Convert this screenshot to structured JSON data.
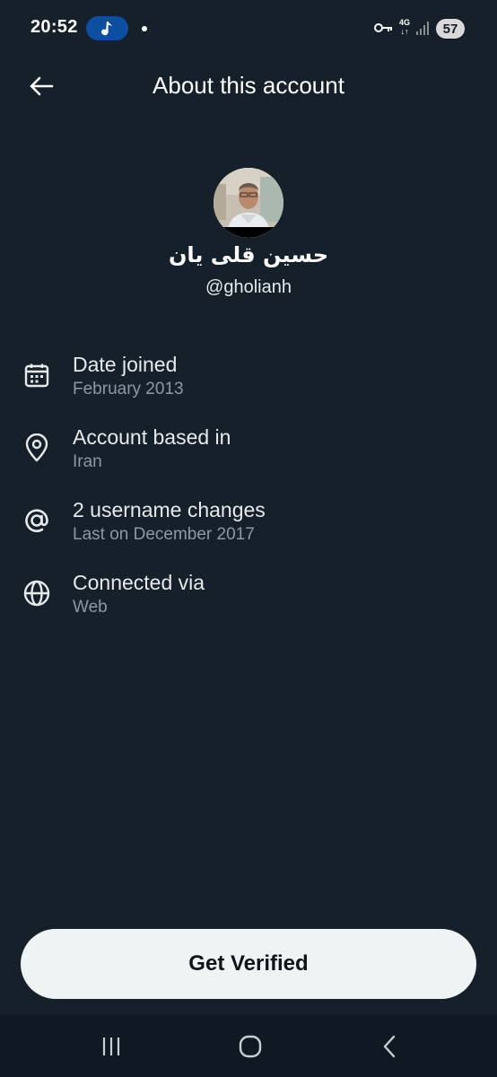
{
  "status_bar": {
    "time": "20:52",
    "network": "4G",
    "battery": "57",
    "icons": [
      "music-note-icon",
      "key-icon",
      "signal-icon"
    ]
  },
  "header": {
    "title": "About this account",
    "back_icon": "arrow-left-icon"
  },
  "profile": {
    "display_name": "حسین قلی یان",
    "handle": "@gholianh"
  },
  "info_items": [
    {
      "icon": "calendar-icon",
      "title": "Date joined",
      "subtitle": "February 2013"
    },
    {
      "icon": "location-pin-icon",
      "title": "Account based in",
      "subtitle": "Iran"
    },
    {
      "icon": "at-sign-icon",
      "title": "2 username changes",
      "subtitle": "Last on December 2017"
    },
    {
      "icon": "globe-icon",
      "title": "Connected via",
      "subtitle": "Web"
    }
  ],
  "action": {
    "label": "Get Verified"
  },
  "nav_bar": {
    "icons": [
      "recent-apps-icon",
      "home-icon",
      "back-nav-icon"
    ]
  },
  "colors": {
    "background": "#15202b",
    "text_primary": "#e7e9ea",
    "text_secondary": "#8b98a5",
    "button_bg": "#eff3f4",
    "music_pill": "#0b4ea2"
  }
}
